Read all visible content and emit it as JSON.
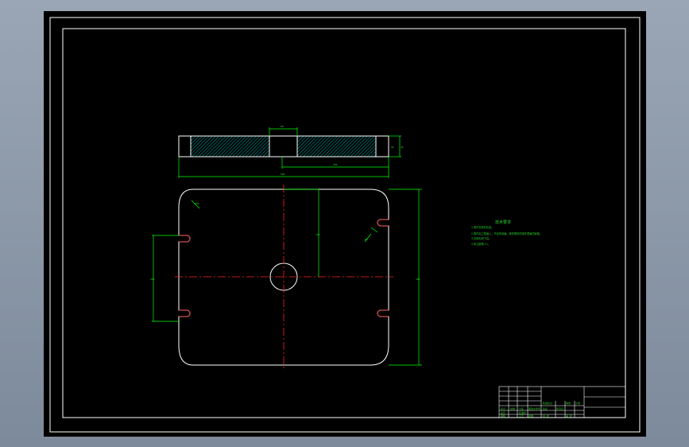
{
  "drawing": {
    "background": "#000000",
    "linework_color": "#ffffff",
    "dimension_color": "#00ff00",
    "centerline_color": "#ff2020",
    "hatch_color": "#00c8c8",
    "dims": {
      "top_width": "66",
      "top_center_slot": "80",
      "total_length": "500",
      "offset": "300",
      "thickness_right": "25",
      "corner_radius": "R30",
      "hole_radius": "R9",
      "plan_height": "250",
      "overall_height": "300",
      "left_span": "200"
    },
    "notes": {
      "title": "技术要求",
      "lines": [
        "1.零件去除氧化皮。",
        "2.零件加工表面上，不应有划痕、擦伤等损伤零件表面的缺陷。",
        "3.去除毛刺飞边。",
        "4.未注倒角 C1。"
      ]
    },
    "title_block": {
      "cells": [
        "标记",
        "处数",
        "分区",
        "更改文件号",
        "签名",
        "年月日",
        "设计",
        "标准化",
        "阶段标记",
        "重量",
        "比例",
        "审核",
        "工艺",
        "批准",
        "共 张",
        "第 张"
      ]
    }
  }
}
